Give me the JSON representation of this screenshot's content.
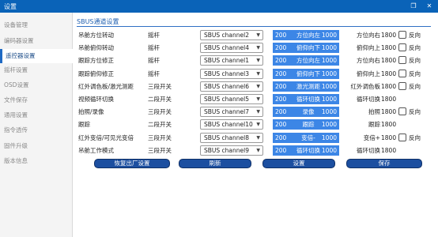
{
  "window": {
    "title": "设置",
    "controls": [
      "❐",
      "✕"
    ]
  },
  "sidebar": {
    "items": [
      {
        "label": "设备管理",
        "active": false
      },
      {
        "label": "编码器设置",
        "active": false
      },
      {
        "label": "遥控器设置",
        "active": true
      },
      {
        "label": "摇杆设置",
        "active": false
      },
      {
        "label": "OSD设置",
        "active": false
      },
      {
        "label": "文件保存",
        "active": false
      },
      {
        "label": "通用设置",
        "active": false
      },
      {
        "label": "指令透传",
        "active": false
      },
      {
        "label": "固件升级",
        "active": false
      },
      {
        "label": "版本信息",
        "active": false
      }
    ]
  },
  "panel": {
    "title": "SBUS通道设置"
  },
  "rows": [
    {
      "name": "吊舱方位转动",
      "type": "摇杆",
      "channel": "SBUS channel2",
      "low": "200",
      "bar_label": "方位向左",
      "high": "1000",
      "output": "方位向右",
      "value": "1800",
      "has_reverse": true,
      "reverse_label": "反向",
      "reverse_checked": false
    },
    {
      "name": "吊舱俯仰转动",
      "type": "摇杆",
      "channel": "SBUS channel4",
      "low": "200",
      "bar_label": "俯仰向下",
      "high": "1000",
      "output": "俯仰向上",
      "value": "1800",
      "has_reverse": true,
      "reverse_label": "反向",
      "reverse_checked": false
    },
    {
      "name": "跟踪方位修正",
      "type": "摇杆",
      "channel": "SBUS channel1",
      "low": "200",
      "bar_label": "方位向左",
      "high": "1000",
      "output": "方位向右",
      "value": "1800",
      "has_reverse": true,
      "reverse_label": "反向",
      "reverse_checked": false
    },
    {
      "name": "跟踪俯仰修正",
      "type": "摇杆",
      "channel": "SBUS channel3",
      "low": "200",
      "bar_label": "俯仰向下",
      "high": "1000",
      "output": "俯仰向上",
      "value": "1800",
      "has_reverse": true,
      "reverse_label": "反向",
      "reverse_checked": false
    },
    {
      "name": "红外调色板/激光测距",
      "type": "三段开关",
      "channel": "SBUS channel6",
      "low": "200",
      "bar_label": "激光测距",
      "high": "1000",
      "output": "红外调色板",
      "value": "1800",
      "has_reverse": true,
      "reverse_label": "反向",
      "reverse_checked": false
    },
    {
      "name": "视频循环切换",
      "type": "二段开关",
      "channel": "SBUS channel5",
      "low": "200",
      "bar_label": "循环切换",
      "high": "1000",
      "output": "循环切换",
      "value": "1800",
      "has_reverse": false,
      "reverse_label": "",
      "reverse_checked": false
    },
    {
      "name": "拍照/录像",
      "type": "三段开关",
      "channel": "SBUS channel7",
      "low": "200",
      "bar_label": "录像",
      "high": "1000",
      "output": "拍照",
      "value": "1800",
      "has_reverse": true,
      "reverse_label": "反向",
      "reverse_checked": false
    },
    {
      "name": "跟踪",
      "type": "二段开关",
      "channel": "SBUS channel10",
      "low": "200",
      "bar_label": "跟踪",
      "high": "1000",
      "output": "跟踪",
      "value": "1800",
      "has_reverse": false,
      "reverse_label": "",
      "reverse_checked": false
    },
    {
      "name": "红外变倍/可见光变倍",
      "type": "三段开关",
      "channel": "SBUS channel8",
      "low": "200",
      "bar_label": "变倍-",
      "high": "1000",
      "output": "变倍+",
      "value": "1800",
      "has_reverse": true,
      "reverse_label": "反向",
      "reverse_checked": false
    },
    {
      "name": "吊舱工作模式",
      "type": "三段开关",
      "channel": "SBUS channel9",
      "low": "200",
      "bar_label": "循环切换",
      "high": "1000",
      "output": "循环切换",
      "value": "1800",
      "has_reverse": false,
      "reverse_label": "",
      "reverse_checked": false
    }
  ],
  "buttons": {
    "restore": "恢复出厂设置",
    "refresh": "刷新",
    "set": "设置",
    "save": "保存"
  }
}
